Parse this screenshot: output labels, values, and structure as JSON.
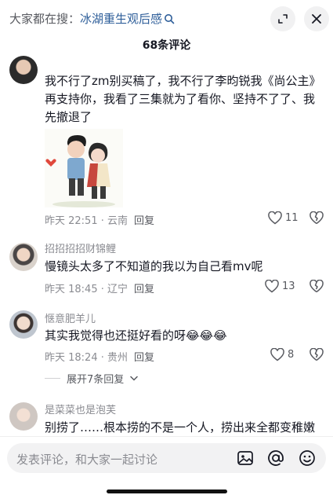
{
  "search": {
    "prefix": "大家都在搜：",
    "keyword": "冰湖重生观后感"
  },
  "header": {
    "comment_count": "68条评论"
  },
  "comments": [
    {
      "text": "我不行了zm别买稿了，我不行了李昀锐我《尚公主》再支持你，我看了三集就为了看你、坚持不了了、我先撤退了",
      "meta": "昨天 22:51 · 云南",
      "reply_label": "回复",
      "likes": "11"
    },
    {
      "user": "招招招招财锦鲤",
      "text": "慢镜头太多了不知道的我以为自己看mv呢",
      "meta": "昨天 18:45 · 辽宁",
      "reply_label": "回复",
      "likes": "13"
    },
    {
      "user": "惬意肥羊儿",
      "text": "其实我觉得也还挺好看的呀",
      "emoji": "😂😂😂",
      "meta": "昨天 18:24 · 贵州",
      "reply_label": "回复",
      "likes": "8",
      "expand_label": "展开7条回复"
    },
    {
      "user": "是菜菜也是泡芙",
      "text": "别捞了……根本捞的不是一个人，捞出来全都变稚嫩"
    }
  ],
  "composer": {
    "placeholder": "发表评论，和大家一起讨论"
  }
}
